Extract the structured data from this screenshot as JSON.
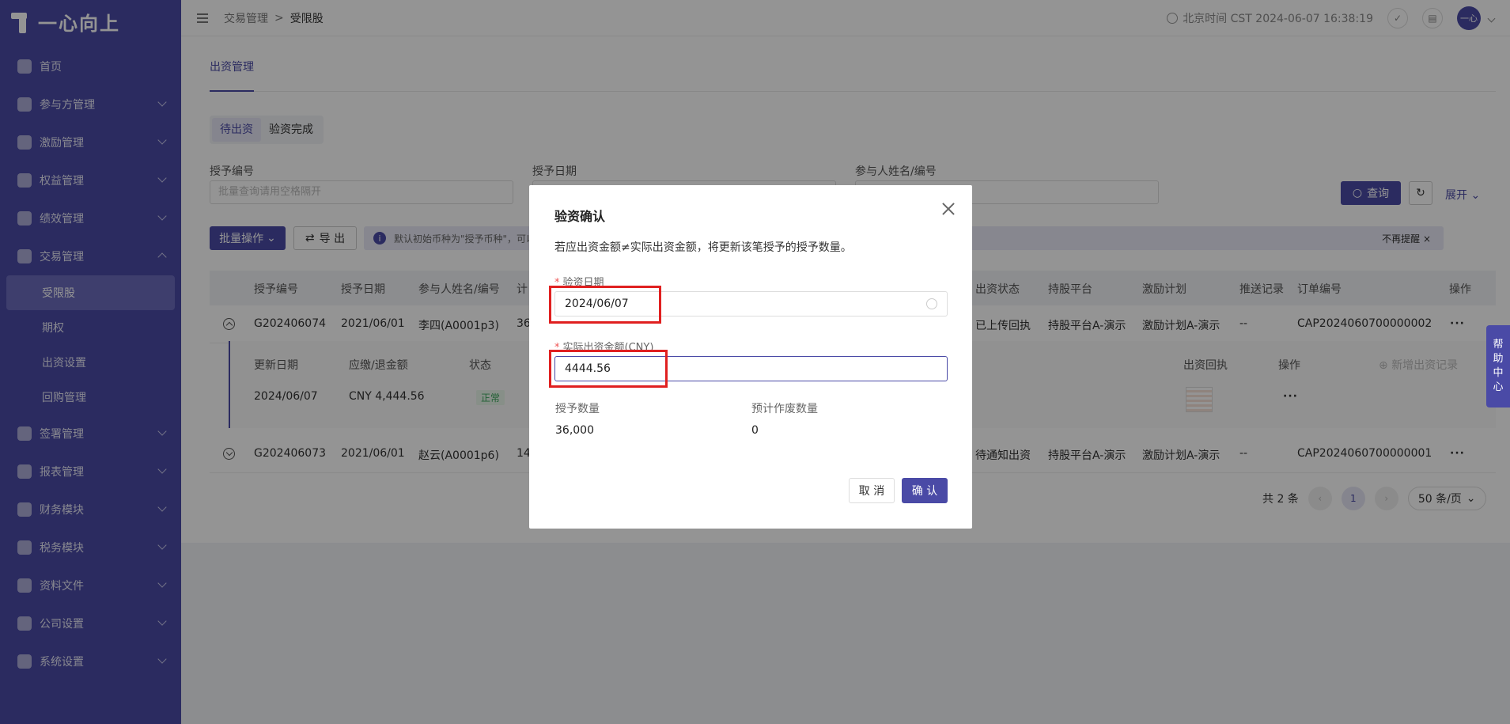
{
  "app": {
    "logo_text": "一心向上"
  },
  "sidebar": {
    "items": [
      {
        "label": "首页"
      },
      {
        "label": "参与方管理"
      },
      {
        "label": "激励管理"
      },
      {
        "label": "权益管理"
      },
      {
        "label": "绩效管理"
      },
      {
        "label": "交易管理"
      },
      {
        "label": "签署管理"
      },
      {
        "label": "报表管理"
      },
      {
        "label": "财务模块"
      },
      {
        "label": "税务模块"
      },
      {
        "label": "资料文件"
      },
      {
        "label": "公司设置"
      },
      {
        "label": "系统设置"
      }
    ],
    "sub_items": [
      {
        "label": "受限股"
      },
      {
        "label": "期权"
      },
      {
        "label": "出资设置"
      },
      {
        "label": "回购管理"
      }
    ]
  },
  "header": {
    "breadcrumb": [
      "交易管理",
      "受限股"
    ],
    "time": "北京时间 CST 2024-06-07 16:38:19",
    "avatar_text": "一心"
  },
  "main": {
    "tab": "出资管理",
    "segments": [
      "待出资",
      "验资完成"
    ],
    "filters": {
      "grant_no_label": "授予编号",
      "grant_no_placeholder": "批量查询请用空格隔开",
      "grant_date_label": "授予日期",
      "participant_label": "参与人姓名/编号"
    },
    "query_btn": "查询",
    "expand_btn": "展开",
    "batch_btn": "批量操作",
    "export_btn": "导 出",
    "notice": "默认初始币种为\"授予币种\"，可以",
    "notice_close": "不再提醒",
    "table_headers": [
      "授予编号",
      "授予日期",
      "参与人姓名/编号",
      "计",
      "出资状态",
      "持股平台",
      "激励计划",
      "推送记录",
      "订单编号",
      "操作"
    ],
    "rows": [
      {
        "grant_no": "G202406074",
        "date": "2021/06/01",
        "participant": "李四(A0001p3)",
        "qty": "36",
        "status": "已上传回执",
        "platform": "持股平台A-演示",
        "plan": "激励计划A-演示",
        "push": "--",
        "order": "CAP2024060700000002",
        "ops": "···"
      },
      {
        "grant_no": "G202406073",
        "date": "2021/06/01",
        "participant": "赵云(A0001p6)",
        "qty": "14",
        "status": "待通知出资",
        "platform": "持股平台A-演示",
        "plan": "激励计划A-演示",
        "push": "--",
        "order": "CAP2024060700000001",
        "ops": "···"
      }
    ],
    "sub_table": {
      "headers": [
        "更新日期",
        "应缴/退金额",
        "状态",
        "出资回执",
        "操作"
      ],
      "add_record": "新增出资记录",
      "row": {
        "date": "2024/06/07",
        "amount": "CNY 4,444.56",
        "status": "正常",
        "ops": "···"
      }
    },
    "pager": {
      "total": "共 2 条",
      "page": "1",
      "page_size": "50 条/页"
    }
  },
  "help": {
    "label": [
      "帮",
      "助",
      "中",
      "心"
    ]
  },
  "modal": {
    "title": "验资确认",
    "desc": "若应出资金额≠实际出资金额，将更新该笔授予的授予数量。",
    "date_label": "验资日期",
    "date_value": "2024/06/07",
    "amount_label": "实际出资金额(CNY)",
    "amount_value": "4444.56",
    "grant_qty_label": "授予数量",
    "grant_qty_value": "36,000",
    "void_qty_label": "预计作废数量",
    "void_qty_value": "0",
    "cancel": "取 消",
    "confirm": "确 认"
  }
}
